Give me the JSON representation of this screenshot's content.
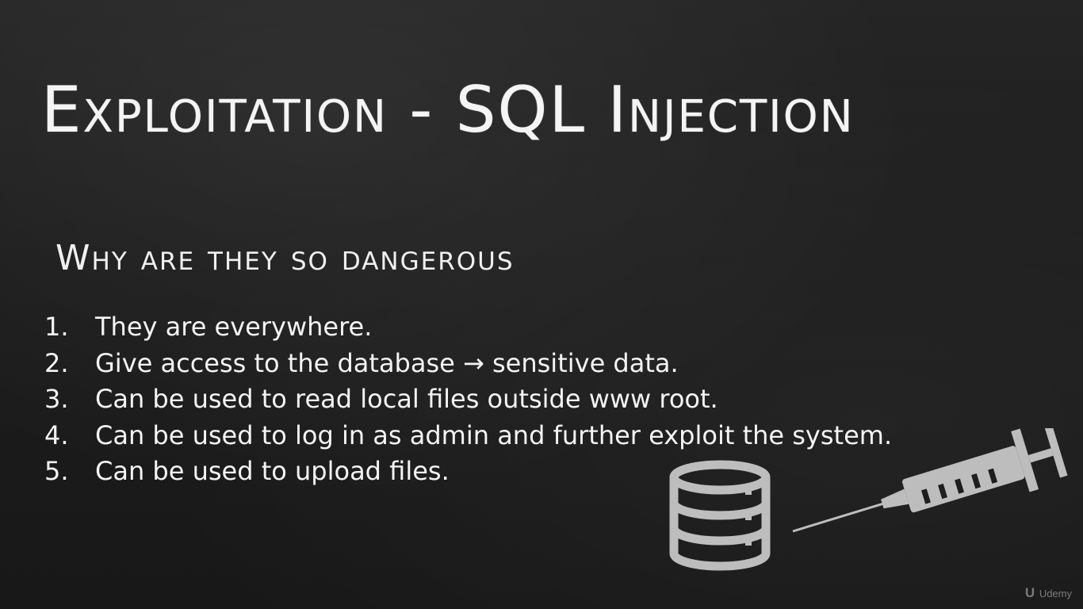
{
  "slide": {
    "title": "Exploitation - SQL Injection",
    "subtitle": "Why are they so dangerous",
    "items": [
      {
        "num": "1.",
        "text": "They are everywhere."
      },
      {
        "num": "2.",
        "text": "Give access to the database → sensitive data."
      },
      {
        "num": "3.",
        "text": "Can be used to read local files outside www root."
      },
      {
        "num": "4.",
        "text": "Can be used to log in as admin and further exploit the system."
      },
      {
        "num": "5.",
        "text": "Can be used to upload files."
      }
    ]
  },
  "illustration": {
    "icons": [
      "database-icon",
      "syringe-icon"
    ],
    "color": "#bdbdbd"
  },
  "watermark": {
    "logo": "U",
    "text": "Udemy"
  },
  "colors": {
    "background": "#1e1e1e",
    "text": "#f4f4f4"
  }
}
